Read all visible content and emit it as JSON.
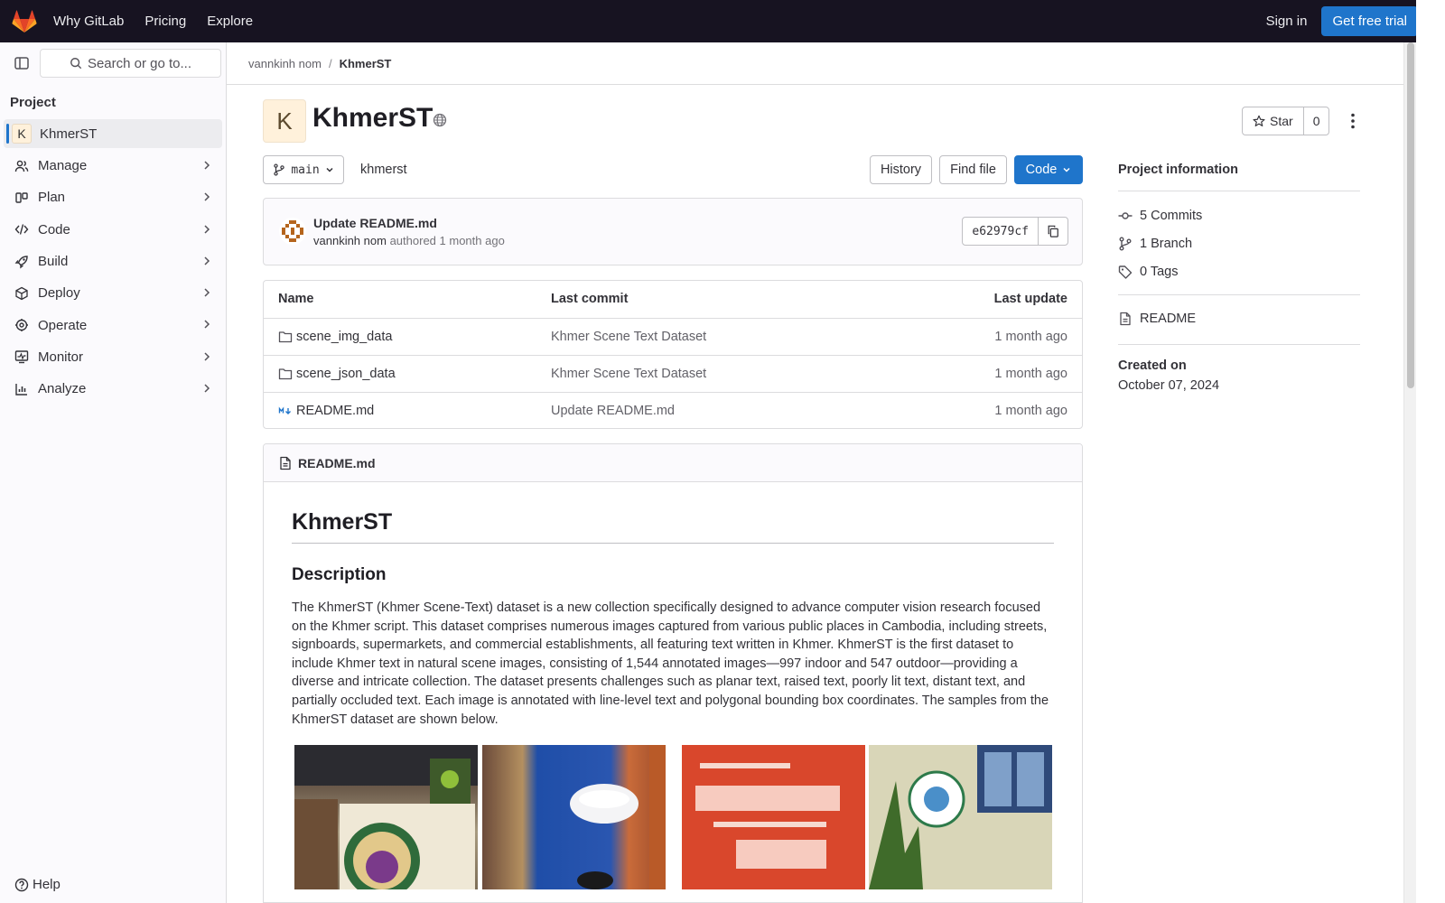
{
  "topbar": {
    "nav": [
      "Why GitLab",
      "Pricing",
      "Explore"
    ],
    "sign_in": "Sign in",
    "trial": "Get free trial"
  },
  "sidebar": {
    "search_label": "Search or go to...",
    "section": "Project",
    "project": {
      "avatar_letter": "K",
      "name": "KhmerST"
    },
    "items": [
      {
        "label": "Manage",
        "icon": "users-icon"
      },
      {
        "label": "Plan",
        "icon": "plan-icon"
      },
      {
        "label": "Code",
        "icon": "code-icon"
      },
      {
        "label": "Build",
        "icon": "rocket-icon"
      },
      {
        "label": "Deploy",
        "icon": "deploy-icon"
      },
      {
        "label": "Operate",
        "icon": "operate-icon"
      },
      {
        "label": "Monitor",
        "icon": "monitor-icon"
      },
      {
        "label": "Analyze",
        "icon": "chart-icon"
      }
    ],
    "help": "Help"
  },
  "breadcrumb": {
    "owner": "vannkinh nom",
    "separator": "/",
    "project": "KhmerST"
  },
  "header": {
    "avatar_letter": "K",
    "title": "KhmerST",
    "star_label": "Star",
    "star_count": "0"
  },
  "toolbar": {
    "branch": "main",
    "path": "khmerst",
    "history": "History",
    "find_file": "Find file",
    "code": "Code"
  },
  "commit": {
    "message": "Update README.md",
    "author": "vannkinh nom",
    "authored": "authored",
    "time": "1 month ago",
    "sha": "e62979cf"
  },
  "files": {
    "headers": [
      "Name",
      "Last commit",
      "Last update"
    ],
    "rows": [
      {
        "name": "scene_img_data",
        "icon": "folder-icon",
        "commit": "Khmer Scene Text Dataset",
        "updated": "1 month ago"
      },
      {
        "name": "scene_json_data",
        "icon": "folder-icon",
        "commit": "Khmer Scene Text Dataset",
        "updated": "1 month ago"
      },
      {
        "name": "README.md",
        "icon": "markdown-icon",
        "commit": "Update README.md",
        "updated": "1 month ago"
      }
    ]
  },
  "readme": {
    "filename": "README.md",
    "h1": "KhmerST",
    "h2": "Description",
    "body": "The KhmerST (Khmer Scene-Text) dataset is a new collection specifically designed to advance computer vision research focused on the Khmer script. This dataset comprises numerous images captured from various public places in Cambodia, including streets, signboards, supermarkets, and commercial establishments, all featuring text written in Khmer. KhmerST is the first dataset to include Khmer text in natural scene images, consisting of 1,544 annotated images—997 indoor and 547 outdoor—providing a diverse and intricate collection. The dataset presents challenges such as planar text, raised text, poorly lit text, distant text, and partially occluded text. Each image is annotated with line-level text and polygonal bounding box coordinates. The samples from the KhmerST dataset are shown below."
  },
  "project_info": {
    "title": "Project information",
    "commits": "5 Commits",
    "branches": "1 Branch",
    "tags": "0 Tags",
    "readme": "README",
    "created_label": "Created on",
    "created_date": "October 07, 2024"
  },
  "colors": {
    "topbar": "#171321",
    "accent": "#1f75cb",
    "sidebar": "#fbfafd"
  }
}
